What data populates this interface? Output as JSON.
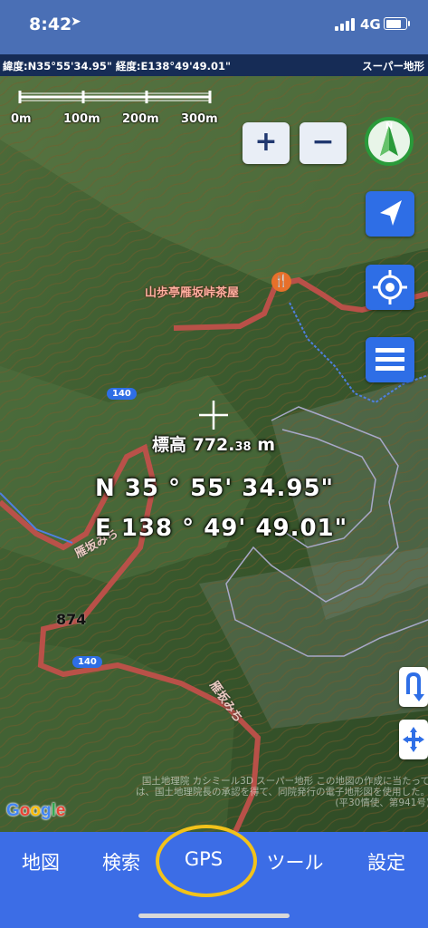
{
  "status": {
    "time": "8:42",
    "network": "4G",
    "battery_level": 0.8
  },
  "coordbar": {
    "left": "緯度:N35°55'34.95\" 経度:E138°49'49.01\"",
    "right": "スーパー地形"
  },
  "scale": {
    "labels": [
      "0m",
      "100m",
      "200m",
      "300m"
    ]
  },
  "controls": {
    "zoom_in": "+",
    "zoom_out": "−",
    "compass_letter": "N"
  },
  "center": {
    "elevation_prefix": "標高 772.",
    "elevation_decimal": "38",
    "elevation_unit": " m",
    "lat": "N  35 °  55'  34.95\"",
    "lon": "E 138 °  49'  49.01\""
  },
  "map_labels": {
    "shop": "山歩亭雁坂峠茶屋",
    "road_label_1": "雁坂みち",
    "road_label_2": "雁坂みち",
    "route_badge_1": "140",
    "route_badge_2": "140",
    "spot_height": "874"
  },
  "attribution": {
    "google": [
      "G",
      "o",
      "o",
      "g",
      "l",
      "e"
    ],
    "text": "国土地理院 カシミール3D スーパー地形 この地図の作成に当たっては、国土地理院長の承認を得て、同院発行の電子地形図を使用した。(平30情使、第941号)"
  },
  "tabs": [
    {
      "label": "地図"
    },
    {
      "label": "検索"
    },
    {
      "label": "GPS"
    },
    {
      "label": "ツール"
    },
    {
      "label": "設定"
    }
  ],
  "colors": {
    "tabbar": "#3c6de6",
    "highlight_ring": "#f2c21a",
    "button_blue": "#2e6ee6"
  }
}
